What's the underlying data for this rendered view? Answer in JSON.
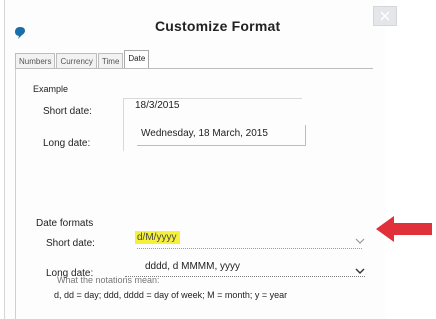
{
  "dialog": {
    "title": "Customize Format",
    "app_icon": "app-logo-icon",
    "close_icon": "close-icon"
  },
  "tabs": [
    {
      "label": "Numbers",
      "active": false
    },
    {
      "label": "Currency",
      "active": false
    },
    {
      "label": "Time",
      "active": false
    },
    {
      "label": "Date",
      "active": true
    }
  ],
  "example": {
    "heading": "Example",
    "short_label": "Short date:",
    "short_value": "18/3/2015",
    "long_label": "Long date:",
    "long_value": "Wednesday, 18 March, 2015"
  },
  "formats": {
    "heading": "Date formats",
    "short_label": "Short date:",
    "short_value": "d/M/yyyy",
    "long_label": "Long date:",
    "long_value": "dddd, d MMMM, yyyy"
  },
  "notations": {
    "heading": "What the notations mean:",
    "text": "d, dd = day;  ddd, dddd = day of week;  M = month;  y = year"
  },
  "colors": {
    "highlight": "#f5f03c",
    "arrow": "#e0303a"
  }
}
